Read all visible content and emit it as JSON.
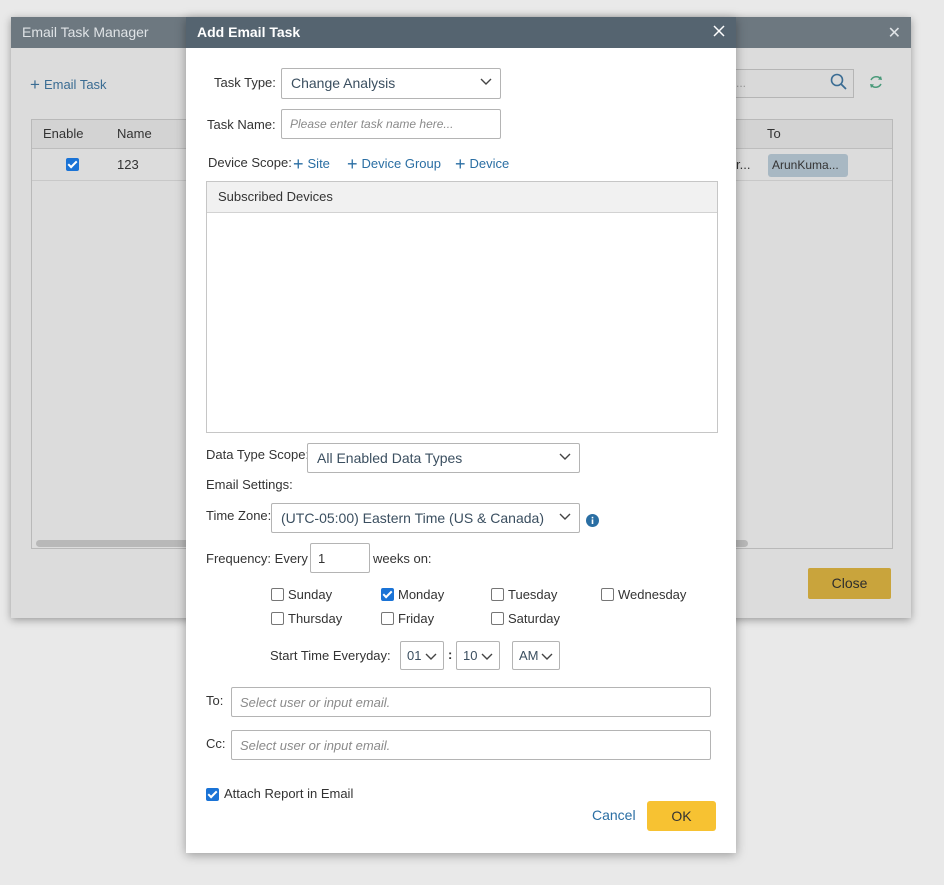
{
  "background_window": {
    "title": "Email Task Manager",
    "add_label": "Email Task",
    "search_placeholder": "...",
    "columns": [
      "Enable",
      "Name",
      "To"
    ],
    "row": {
      "name": "123",
      "partial": "r...",
      "to_chip": "ArunKuma..."
    },
    "close_label": "Close"
  },
  "modal": {
    "title": "Add Email Task",
    "task_type": {
      "label": "Task Type:",
      "value": "Change Analysis"
    },
    "task_name": {
      "label": "Task Name:",
      "placeholder": "Please enter task name here..."
    },
    "device_scope": {
      "label": "Device Scope:",
      "links": [
        "Site",
        "Device Group",
        "Device"
      ]
    },
    "subscribed_devices": {
      "header": "Subscribed Devices"
    },
    "data_type_scope": {
      "label": "Data Type Scope:",
      "value": "All Enabled Data Types"
    },
    "email_settings_label": "Email Settings:",
    "time_zone": {
      "label": "Time Zone:",
      "value": "(UTC-05:00) Eastern Time (US & Canada)"
    },
    "frequency": {
      "label": "Frequency: Every",
      "value": "1",
      "suffix": "weeks on:"
    },
    "days": [
      {
        "label": "Sunday",
        "checked": false
      },
      {
        "label": "Monday",
        "checked": true
      },
      {
        "label": "Tuesday",
        "checked": false
      },
      {
        "label": "Wednesday",
        "checked": false
      },
      {
        "label": "Thursday",
        "checked": false
      },
      {
        "label": "Friday",
        "checked": false
      },
      {
        "label": "Saturday",
        "checked": false
      }
    ],
    "start_time": {
      "label": "Start Time Everyday:",
      "hour": "01",
      "separator": ":",
      "minute": "10",
      "ampm": "AM"
    },
    "to": {
      "label": "To:",
      "placeholder": "Select user or input email."
    },
    "cc": {
      "label": "Cc:",
      "placeholder": "Select user or input email."
    },
    "attach_report": {
      "label": "Attach Report in Email",
      "checked": true
    },
    "cancel_label": "Cancel",
    "ok_label": "OK"
  },
  "colors": {
    "modal_titlebar": "#556470",
    "accent_blue": "#2a6ea3",
    "ok_button": "#f7c232",
    "checkbox_checked": "#1a73d6"
  }
}
